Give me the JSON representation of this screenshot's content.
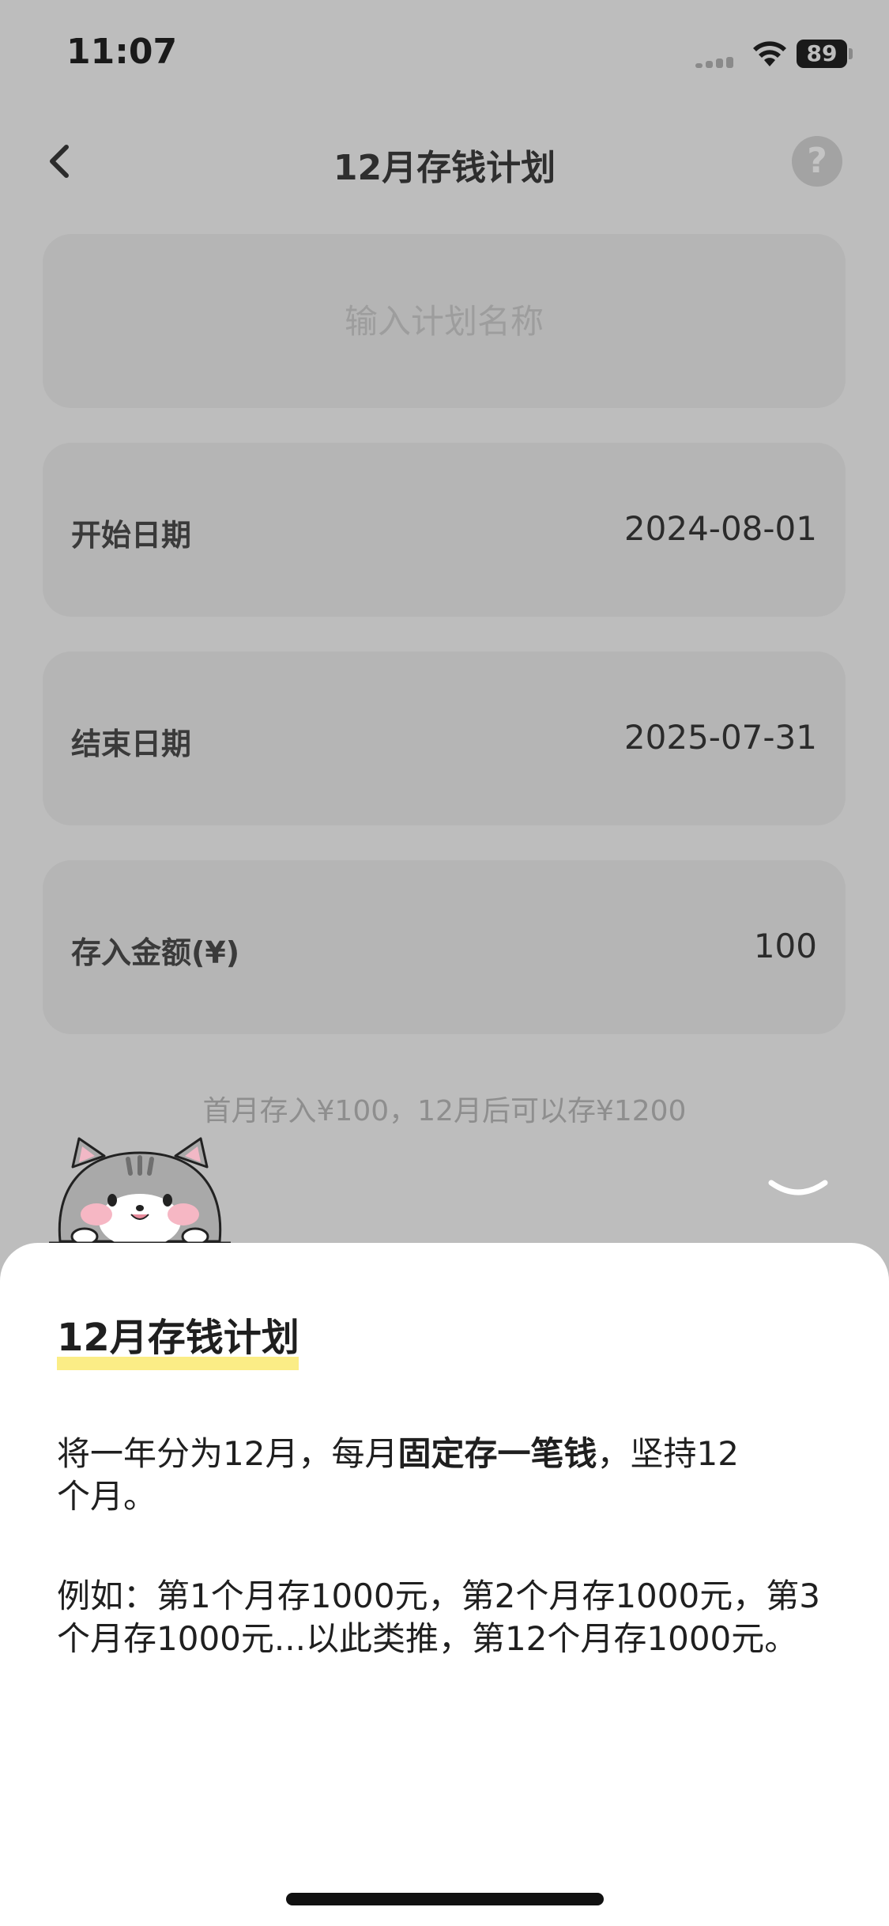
{
  "status_bar": {
    "time": "11:07",
    "battery": "89"
  },
  "nav": {
    "title": "12月存钱计划"
  },
  "form": {
    "name_placeholder": "输入计划名称",
    "start_date": {
      "label": "开始日期",
      "value": "2024-08-01"
    },
    "end_date": {
      "label": "结束日期",
      "value": "2025-07-31"
    },
    "amount": {
      "label": "存入金额(¥)",
      "value": "100"
    }
  },
  "hint": "首月存入¥100，12月后可以存¥1200",
  "sheet": {
    "title": "12月存钱计划",
    "para1_before": "将一年分为12月，每月",
    "para1_bold": "固定存一笔钱",
    "para1_after": "，坚持12个月。",
    "para2": "例如：第1个月存1000元，第2个月存1000元，第3个月存1000元...以此类推，第12个月存1000元。"
  },
  "colors": {
    "overlay_bg": "#bdbdbd",
    "card_bg": "#b5b5b5",
    "sheet_bg": "#ffffff",
    "title_underline": "#fbed86"
  },
  "icons": [
    "back-icon",
    "help-icon",
    "wifi-icon",
    "cellular-signal-icon",
    "battery-icon",
    "cat-mascot-icon",
    "chevron-down-icon"
  ]
}
